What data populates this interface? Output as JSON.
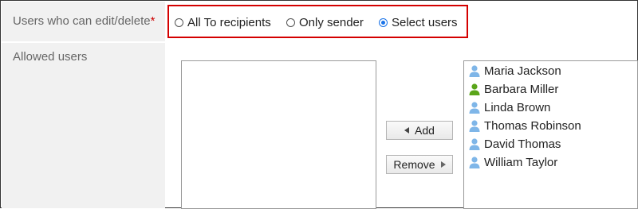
{
  "edit_permission": {
    "label": "Users who can edit/delete",
    "required_mark": "*",
    "options": [
      {
        "label": "All To recipients",
        "checked": false
      },
      {
        "label": "Only sender",
        "checked": false
      },
      {
        "label": "Select users",
        "checked": true
      }
    ]
  },
  "allowed_users": {
    "label": "Allowed users",
    "add_label": "Add",
    "remove_label": "Remove",
    "candidates": [
      {
        "name": "Maria Jackson",
        "icon": "user-icon",
        "color": "#7fb6e8"
      },
      {
        "name": "Barbara Miller",
        "icon": "user-icon",
        "color": "#5aa51a"
      },
      {
        "name": "Linda Brown",
        "icon": "user-icon",
        "color": "#7fb6e8"
      },
      {
        "name": "Thomas Robinson",
        "icon": "user-icon",
        "color": "#7fb6e8"
      },
      {
        "name": "David Thomas",
        "icon": "user-icon",
        "color": "#7fb6e8"
      },
      {
        "name": "William Taylor",
        "icon": "user-icon",
        "color": "#7fb6e8"
      }
    ]
  }
}
